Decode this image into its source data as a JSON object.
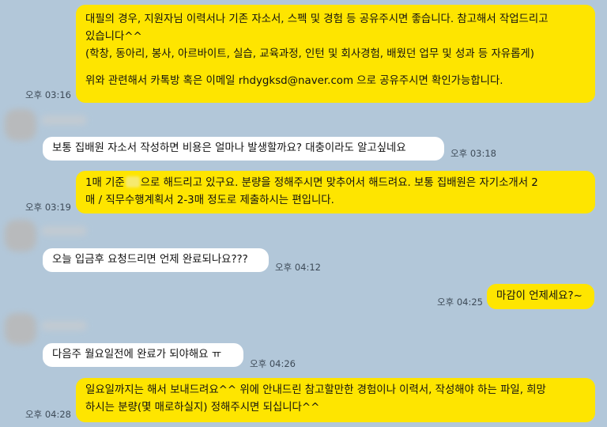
{
  "messages": [
    {
      "sender": "me",
      "lines": [
        "대필의 경우, 지원자님 이력서나 기존 자소서, 스펙 및 경험 등 공유주시면 좋습니다. 참고해서 작업드리고",
        "있습니다^^",
        "(학창, 동아리, 봉사, 아르바이트, 실습, 교육과정, 인턴 및 회사경험, 배웠던 업무 및 성과 등 자유롭게)",
        "",
        "위와 관련해서 카톡방 혹은 이메일 rhdygksd@naver.com 으로 공유주시면 확인가능합니다."
      ],
      "time": "오후 03:16"
    },
    {
      "sender": "other",
      "lines": [
        "보통 집배원 자소서 작성하면 비용은 얼마나 발생할까요? 대충이라도 알고싶네요"
      ],
      "time": "오후 03:18"
    },
    {
      "sender": "me",
      "line1_before": "1매 기준",
      "line1_after": "으로 해드리고 있구요. 분량을 정해주시면 맞추어서 해드려요. 보통 집배원은 자기소개서 2",
      "line2": "매 / 직무수행계획서 2-3매 정도로 제출하시는 편입니다.",
      "time": "오후 03:19"
    },
    {
      "sender": "other",
      "lines": [
        "오늘 입금후 요청드리면 언제 완료되나요???"
      ],
      "time": "오후 04:12"
    },
    {
      "sender": "me",
      "lines": [
        "마감이 언제세요?~"
      ],
      "time": "오후 04:25"
    },
    {
      "sender": "other",
      "lines": [
        "다음주 월요일전에 완료가 되야해요 ㅠ"
      ],
      "time": "오후 04:26"
    },
    {
      "sender": "me",
      "lines": [
        "일요일까지는 해서 보내드려요^^ 위에 안내드린 참고할만한 경험이나 이력서, 작성해야 하는 파일, 희망",
        "하시는 분량(몇 매로하실지) 정해주시면 되십니다^^"
      ],
      "time": "오후 04:28"
    }
  ],
  "colors": {
    "background": "#b2c7d9",
    "my_bubble": "#fee500",
    "other_bubble": "#ffffff"
  }
}
